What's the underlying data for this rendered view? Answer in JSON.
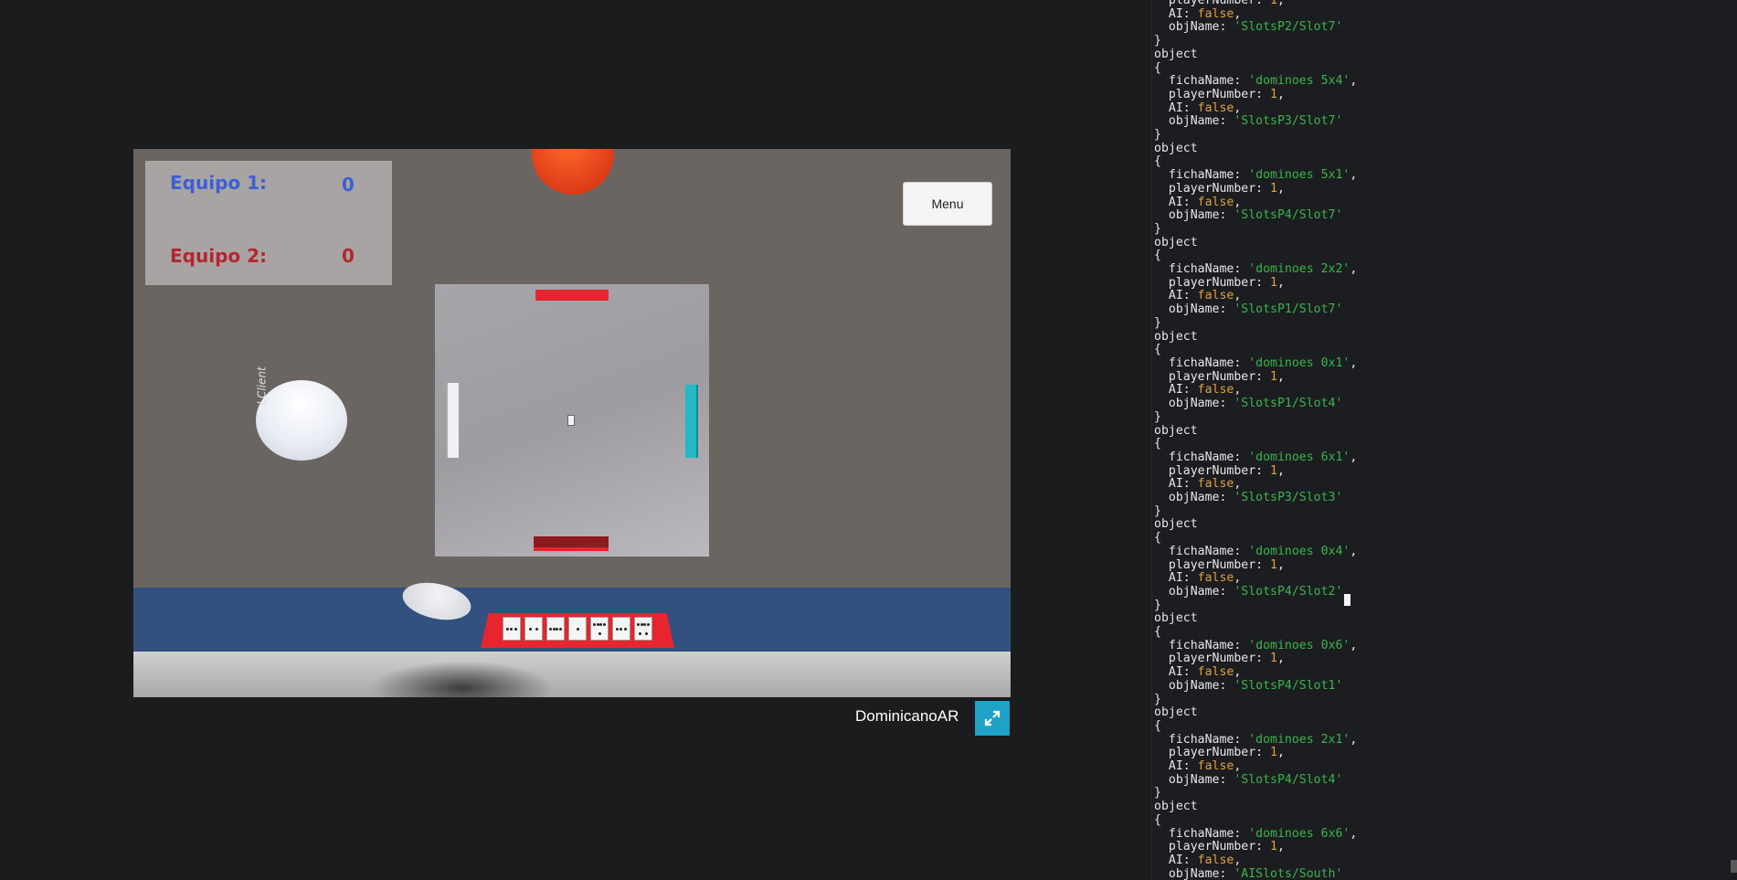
{
  "scoreboard": {
    "team1_label": "Equipo 1:",
    "team1_score": "0",
    "team2_label": "Equipo 2:",
    "team2_score": "0"
  },
  "menu_label": "Menu",
  "ball_text": "LClient",
  "footer_title": "DominicanoAR",
  "icons": {
    "fullscreen": "expand-icon"
  },
  "colors": {
    "team1": "#3d5fd6",
    "team2": "#b3262d",
    "accent": "#1fa1c8",
    "string": "#39b54a",
    "keyword_value": "#e0a23a"
  },
  "console": {
    "partial_top": [
      {
        "key": "  playerNumber: ",
        "value": "1",
        "type": "num",
        "suffix": ","
      },
      {
        "key": "  AI: ",
        "value": "false",
        "type": "bool",
        "suffix": ","
      },
      {
        "key": "  objName: ",
        "value": "'SlotsP2/Slot7'",
        "type": "str",
        "suffix": ""
      }
    ],
    "objects": [
      {
        "fichaName": "'dominoes 5x4'",
        "playerNumber": "1",
        "AI": "false",
        "objName": "'SlotsP3/Slot7'"
      },
      {
        "fichaName": "'dominoes 5x1'",
        "playerNumber": "1",
        "AI": "false",
        "objName": "'SlotsP4/Slot7'"
      },
      {
        "fichaName": "'dominoes 2x2'",
        "playerNumber": "1",
        "AI": "false",
        "objName": "'SlotsP1/Slot7'"
      },
      {
        "fichaName": "'dominoes 0x1'",
        "playerNumber": "1",
        "AI": "false",
        "objName": "'SlotsP1/Slot4'"
      },
      {
        "fichaName": "'dominoes 6x1'",
        "playerNumber": "1",
        "AI": "false",
        "objName": "'SlotsP3/Slot3'"
      },
      {
        "fichaName": "'dominoes 0x4'",
        "playerNumber": "1",
        "AI": "false",
        "objName": "'SlotsP4/Slot2'"
      },
      {
        "fichaName": "'dominoes 0x6'",
        "playerNumber": "1",
        "AI": "false",
        "objName": "'SlotsP4/Slot1'"
      },
      {
        "fichaName": "'dominoes 2x1'",
        "playerNumber": "1",
        "AI": "false",
        "objName": "'SlotsP4/Slot4'"
      },
      {
        "fichaName": "'dominoes 6x6'",
        "playerNumber": "1",
        "AI": "false",
        "objName": "'AISlots/South'"
      }
    ],
    "object_word": "object",
    "open_brace": "{",
    "close_brace": "}"
  }
}
